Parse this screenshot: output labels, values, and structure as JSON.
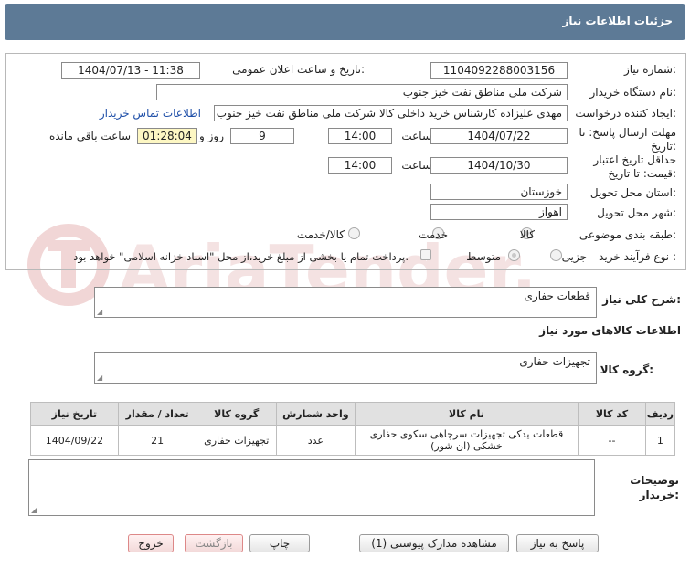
{
  "header": {
    "title": "جزئیات اطلاعات نیاز"
  },
  "form": {
    "need_number_label": "شماره نیاز:",
    "need_number": "1104092288003156",
    "announce_label": "تاریخ و ساعت اعلان عمومی:",
    "announce_value": "1404/07/13 - 11:38",
    "buyer_org_label": "نام دستگاه خریدار:",
    "buyer_org": "شرکت ملی مناطق نفت خیز جنوب",
    "creator_label": "ایجاد کننده درخواست:",
    "creator": "مهدی  علیزاده  کارشناس خرید داخلی کالا شرکت ملی مناطق نفت خیز جنوب",
    "contact_link": "اطلاعات تماس خریدار",
    "deadline_label_1": "مهلت ارسال پاسخ: تا",
    "deadline_label_2": "تاریخ:",
    "deadline_date": "1404/07/22",
    "time_label": "ساعت",
    "deadline_time": "14:00",
    "days_value": "9",
    "days_label": "روز و",
    "remaining_time": "01:28:04",
    "remaining_label": "ساعت باقی مانده",
    "validity_label_1": "حداقل تاریخ اعتبار",
    "validity_label_2": "قیمت: تا تاریخ:",
    "validity_date": "1404/10/30",
    "validity_time": "14:00",
    "province_label": "استان محل تحویل:",
    "province": "خوزستان",
    "city_label": "شهر محل تحویل:",
    "city": "اهواز",
    "category_label": "طبقه بندی موضوعی:",
    "category_options": [
      "کالا",
      "خدمت",
      "کالا/خدمت"
    ],
    "process_label": "نوع فرآیند خرید :",
    "process_options": [
      "جزیی",
      "متوسط"
    ],
    "payment_note": "پرداخت تمام یا بخشی از مبلغ خرید،از محل \"اسناد خزانه اسلامی\" خواهد بود."
  },
  "description": {
    "label": "شرح کلی نیاز:",
    "value": "قطعات حفاری"
  },
  "goods_info": {
    "section_title": "اطلاعات کالاهای مورد نیاز",
    "group_label": "گروه کالا:",
    "group_value": "تجهیزات حفاری"
  },
  "table": {
    "headers": [
      "ردیف",
      "کد کالا",
      "نام کالا",
      "واحد شمارش",
      "گروه کالا",
      "تعداد / مقدار",
      "تاریخ نیاز"
    ],
    "rows": [
      [
        "1",
        "--",
        "قطعات یدکی تجهیزات سرچاهی سکوی حفاری خشکی (ان شور)",
        "عدد",
        "تجهیزات حفاری",
        "21",
        "1404/09/22"
      ]
    ]
  },
  "notes": {
    "label_1": "توضیحات",
    "label_2": "خریدار:"
  },
  "buttons": {
    "reply": "پاسخ به نیاز",
    "attachments": "مشاهده مدارک پیوستی (1)",
    "print": "چاپ",
    "back": "بازگشت",
    "exit": "خروج"
  },
  "colors": {
    "title_bar": "#5d7a96",
    "link": "#1f4fa8",
    "timer_bg": "#fdf7c3",
    "watermark": "#f1d6d6"
  }
}
